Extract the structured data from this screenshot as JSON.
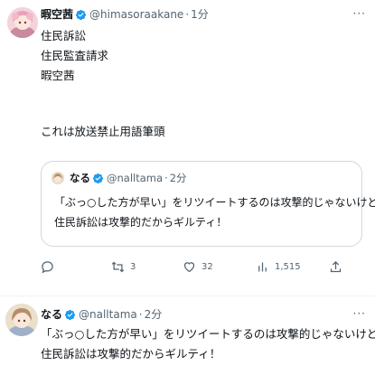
{
  "tweet1": {
    "display_name": "暇空茜",
    "handle": "@himasoraakane",
    "separator": "·",
    "time": "1分",
    "more": "···",
    "lines": [
      "住民訴訟",
      "住民監査請求",
      "暇空茜",
      "",
      "これは放送禁止用語筆頭"
    ],
    "quote": {
      "display_name": "なる",
      "handle": "@nalltama",
      "separator": "·",
      "time": "2分",
      "lines": [
        "「ぶっ○した方が早い」をリツイートするのは攻撃的じゃないけど",
        "住民訴訟は攻撃的だからギルティ！"
      ]
    },
    "actions": {
      "reply": "",
      "retweet": "3",
      "like": "32",
      "views": "1,515"
    }
  },
  "tweet2": {
    "display_name": "なる",
    "handle": "@nalltama",
    "separator": "·",
    "time": "2分",
    "more": "···",
    "lines": [
      "「ぶっ○した方が早い」をリツイートするのは攻撃的じゃないけど",
      "住民訴訟は攻撃的だからギルティ！"
    ]
  },
  "colors": {
    "verified": "#1d9bf0",
    "secondary_text": "#536471",
    "border": "#cfd9de"
  }
}
